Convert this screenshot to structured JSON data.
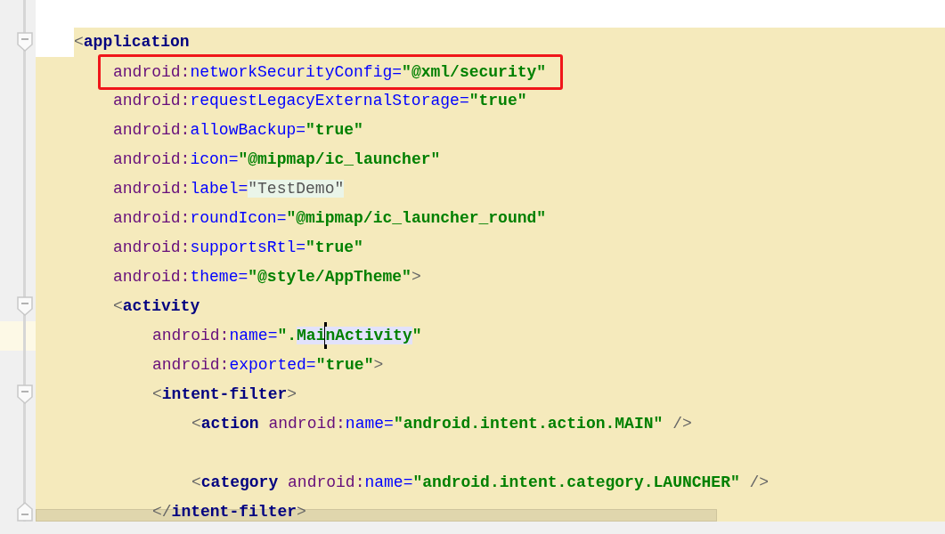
{
  "code": [
    {
      "fold_start": true,
      "tokens": [
        {
          "kind": "bracket",
          "text": "<"
        },
        {
          "kind": "tag",
          "text": "application"
        }
      ],
      "children": [
        {
          "boxed": true,
          "tokens": [
            {
              "kind": "ns",
              "text": "android:"
            },
            {
              "kind": "attr",
              "text": "networkSecurityConfig"
            },
            {
              "kind": "eq",
              "text": "="
            },
            {
              "kind": "value",
              "text": "\"@xml/security\""
            }
          ]
        },
        {
          "tokens": [
            {
              "kind": "ns",
              "text": "android:"
            },
            {
              "kind": "attr",
              "text": "requestLegacyExternalStorage"
            },
            {
              "kind": "eq",
              "text": "="
            },
            {
              "kind": "value",
              "text": "\"true\""
            }
          ]
        },
        {
          "tokens": [
            {
              "kind": "ns",
              "text": "android:"
            },
            {
              "kind": "attr",
              "text": "allowBackup"
            },
            {
              "kind": "eq",
              "text": "="
            },
            {
              "kind": "value",
              "text": "\"true\""
            }
          ]
        },
        {
          "tokens": [
            {
              "kind": "ns",
              "text": "android:"
            },
            {
              "kind": "attr",
              "text": "icon"
            },
            {
              "kind": "eq",
              "text": "="
            },
            {
              "kind": "value",
              "text": "\"@mipmap/ic_launcher\""
            }
          ]
        },
        {
          "tokens": [
            {
              "kind": "ns",
              "text": "android:"
            },
            {
              "kind": "attr",
              "text": "label"
            },
            {
              "kind": "eq",
              "text": "="
            },
            {
              "kind": "folded",
              "text": "\"TestDemo\"",
              "highlighted": true
            }
          ]
        },
        {
          "tokens": [
            {
              "kind": "ns",
              "text": "android:"
            },
            {
              "kind": "attr",
              "text": "roundIcon"
            },
            {
              "kind": "eq",
              "text": "="
            },
            {
              "kind": "value",
              "text": "\"@mipmap/ic_launcher_round\""
            }
          ]
        },
        {
          "tokens": [
            {
              "kind": "ns",
              "text": "android:"
            },
            {
              "kind": "attr",
              "text": "supportsRtl"
            },
            {
              "kind": "eq",
              "text": "="
            },
            {
              "kind": "value",
              "text": "\"true\""
            }
          ]
        },
        {
          "tokens": [
            {
              "kind": "ns",
              "text": "android:"
            },
            {
              "kind": "attr",
              "text": "theme"
            },
            {
              "kind": "eq",
              "text": "="
            },
            {
              "kind": "value",
              "text": "\"@style/AppTheme\""
            },
            {
              "kind": "bracket",
              "text": ">"
            }
          ]
        },
        {
          "fold_start": true,
          "tokens": [
            {
              "kind": "bracket",
              "text": "<"
            },
            {
              "kind": "tag",
              "text": "activity"
            }
          ],
          "children": [
            {
              "current": true,
              "tokens": [
                {
                  "kind": "ns",
                  "text": "android:"
                },
                {
                  "kind": "attr",
                  "text": "name"
                },
                {
                  "kind": "eq",
                  "text": "="
                },
                {
                  "kind": "value",
                  "text": "\"."
                },
                {
                  "kind": "value",
                  "text": "Mai",
                  "highlighted": true
                },
                {
                  "kind": "caret"
                },
                {
                  "kind": "value",
                  "text": "nActivity",
                  "highlighted": true
                },
                {
                  "kind": "value",
                  "text": "\""
                }
              ]
            },
            {
              "tokens": [
                {
                  "kind": "ns",
                  "text": "android:"
                },
                {
                  "kind": "attr",
                  "text": "exported"
                },
                {
                  "kind": "eq",
                  "text": "="
                },
                {
                  "kind": "value",
                  "text": "\"true\""
                },
                {
                  "kind": "bracket",
                  "text": ">"
                }
              ]
            },
            {
              "fold_start": true,
              "tokens": [
                {
                  "kind": "bracket",
                  "text": "<"
                },
                {
                  "kind": "tag",
                  "text": "intent-filter"
                },
                {
                  "kind": "bracket",
                  "text": ">"
                }
              ],
              "children": [
                {
                  "blank_after": true,
                  "tokens": [
                    {
                      "kind": "bracket",
                      "text": "<"
                    },
                    {
                      "kind": "tag",
                      "text": "action"
                    },
                    {
                      "kind": "ns",
                      "text": "android:"
                    },
                    {
                      "kind": "attr",
                      "text": "name"
                    },
                    {
                      "kind": "eq",
                      "text": "="
                    },
                    {
                      "kind": "value",
                      "text": "\"android.intent.action.MAIN\""
                    },
                    {
                      "kind": "selfclose",
                      "text": "/>"
                    }
                  ]
                },
                {
                  "tokens": [
                    {
                      "kind": "bracket",
                      "text": "<"
                    },
                    {
                      "kind": "tag",
                      "text": "category"
                    },
                    {
                      "kind": "ns",
                      "text": "android:"
                    },
                    {
                      "kind": "attr",
                      "text": "name"
                    },
                    {
                      "kind": "eq",
                      "text": "="
                    },
                    {
                      "kind": "value",
                      "text": "\"android.intent.category.LAUNCHER\""
                    },
                    {
                      "kind": "selfclose",
                      "text": "/>"
                    }
                  ]
                }
              ]
            },
            {
              "fold_end": true,
              "tokens": [
                {
                  "kind": "bracket",
                  "text": "</"
                },
                {
                  "kind": "tag",
                  "text": "intent-filter"
                },
                {
                  "kind": "bracket",
                  "text": ">"
                }
              ]
            }
          ]
        }
      ]
    }
  ]
}
